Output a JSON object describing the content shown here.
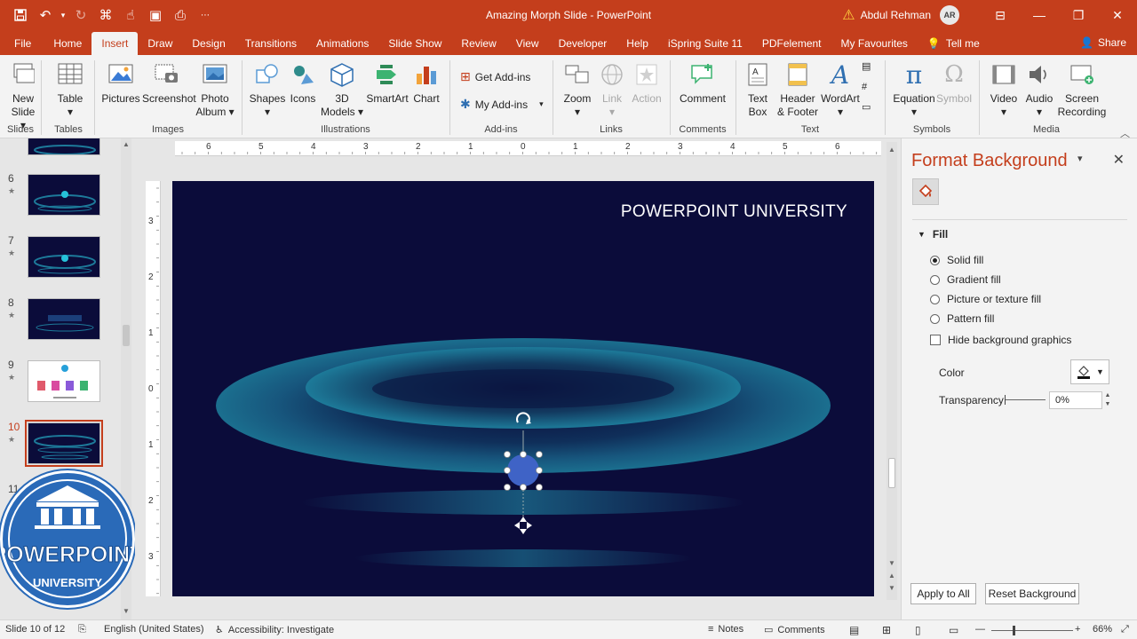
{
  "window": {
    "title": "Amazing Morph Slide  -  PowerPoint",
    "user": "Abdul Rehman",
    "user_initials": "AR"
  },
  "tabs": [
    "File",
    "Home",
    "Insert",
    "Draw",
    "Design",
    "Transitions",
    "Animations",
    "Slide Show",
    "Review",
    "View",
    "Developer",
    "Help",
    "iSpring Suite 11",
    "PDFelement",
    "My Favourites"
  ],
  "active_tab": "Insert",
  "tell_me": "Tell me",
  "share": "Share",
  "ribbon": {
    "new_slide": [
      "New",
      "Slide"
    ],
    "table": "Table",
    "pictures": "Pictures",
    "screenshot": "Screenshot",
    "photo_album": [
      "Photo",
      "Album"
    ],
    "shapes": "Shapes",
    "icons": "Icons",
    "models_3d": [
      "3D",
      "Models"
    ],
    "smartart": "SmartArt",
    "chart": "Chart",
    "get_addins": "Get Add-ins",
    "my_addins": "My Add-ins",
    "zoom": "Zoom",
    "link": "Link",
    "action": "Action",
    "comment": "Comment",
    "text_box": [
      "Text",
      "Box"
    ],
    "header_footer": [
      "Header",
      "& Footer"
    ],
    "wordart": "WordArt",
    "equation": "Equation",
    "symbol": "Symbol",
    "video": "Video",
    "audio": "Audio",
    "screen_recording": [
      "Screen",
      "Recording"
    ],
    "groups": {
      "slides": "Slides",
      "tables": "Tables",
      "images": "Images",
      "illustrations": "Illustrations",
      "addins": "Add-ins",
      "links": "Links",
      "comments": "Comments",
      "text": "Text",
      "symbols": "Symbols",
      "media": "Media"
    }
  },
  "thumbnails": {
    "numbers": [
      "6",
      "7",
      "8",
      "9",
      "10",
      "11"
    ],
    "selected": "10"
  },
  "slide": {
    "title": "POWERPOINT UNIVERSITY"
  },
  "ruler": {
    "h_labels": [
      "6",
      "5",
      "4",
      "3",
      "2",
      "1",
      "0",
      "1",
      "2",
      "3",
      "4",
      "5",
      "6"
    ],
    "v_labels": [
      "3",
      "2",
      "1",
      "0",
      "1",
      "2",
      "3"
    ]
  },
  "format_pane": {
    "title": "Format Background",
    "section": "Fill",
    "options": [
      "Solid fill",
      "Gradient fill",
      "Picture or texture fill",
      "Pattern fill"
    ],
    "selected_option": "Solid fill",
    "hide_bg": "Hide background graphics",
    "color_label": "Color",
    "transparency_label": "Transparency",
    "transparency_value": "0%",
    "apply_all": "Apply to All",
    "reset": "Reset Background"
  },
  "status": {
    "slide_info": "Slide 10 of 12",
    "language": "English (United States)",
    "accessibility": "Accessibility: Investigate",
    "notes": "Notes",
    "comments": "Comments",
    "zoom": "66%"
  },
  "logo": {
    "line1": "POWERPOINT",
    "line2": "UNIVERSITY"
  },
  "colors": {
    "accent": "#c43e1c",
    "slide_bg": "#0b0c3a",
    "ring": "#1b6f8f",
    "logo": "#2a6ab8"
  }
}
